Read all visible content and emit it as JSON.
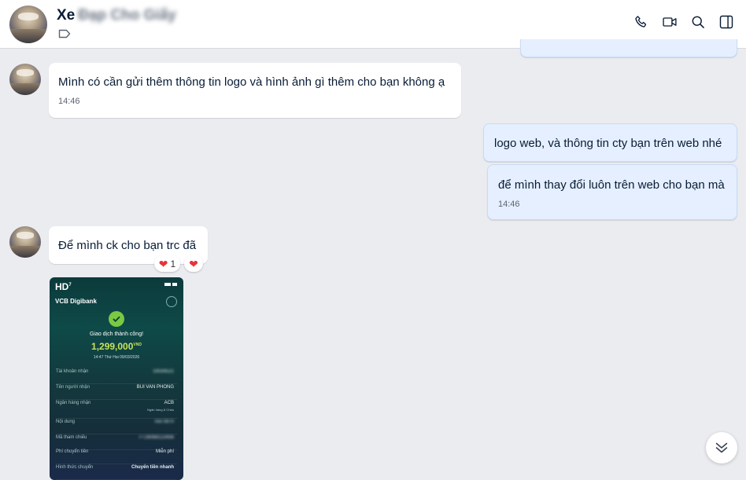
{
  "header": {
    "name_visible": "Xe",
    "name_blurred": "Đạp Cho Giấy"
  },
  "messages": [
    {
      "text": "Mình có cần gửi thêm thông tin logo và hình ảnh gì thêm cho bạn không ạ",
      "time": "14:46"
    },
    {
      "text": "logo web, và thông tin cty bạn trên web nhé"
    },
    {
      "text": "để mình thay đổi luôn trên web cho bạn mà",
      "time": "14:46"
    },
    {
      "text": "Để mình ck cho bạn trc đã",
      "reaction_count": "1"
    }
  ],
  "image": {
    "badge": "HD",
    "badge_sup": "7",
    "bank": "VCB Digibank",
    "success": "Giao dịch thành công!",
    "amount": "1,299,000",
    "currency": "VND",
    "datetime": "14:47 Thứ Hai 09/03/2026",
    "rows": [
      {
        "label": "Tài khoản nhận",
        "value": "19034521"
      },
      {
        "label": "Tên người nhận",
        "value": "BUI VAN PHONG"
      },
      {
        "label": "Ngân hàng nhận",
        "value": "ACB"
      },
      {
        "label": "Nội dung",
        "value": "nxx 0870"
      },
      {
        "label": "Mã tham chiếu",
        "value": "FT26068123456"
      },
      {
        "label": "Phí chuyển tiền",
        "value": "Miễn phí"
      },
      {
        "label": "Hình thức chuyển",
        "value": "Chuyển tiền nhanh"
      }
    ],
    "bank_sub": "Ngân hàng Á Châu"
  },
  "colors": {
    "accent": "#e5efff",
    "heart": "#e4353b"
  }
}
